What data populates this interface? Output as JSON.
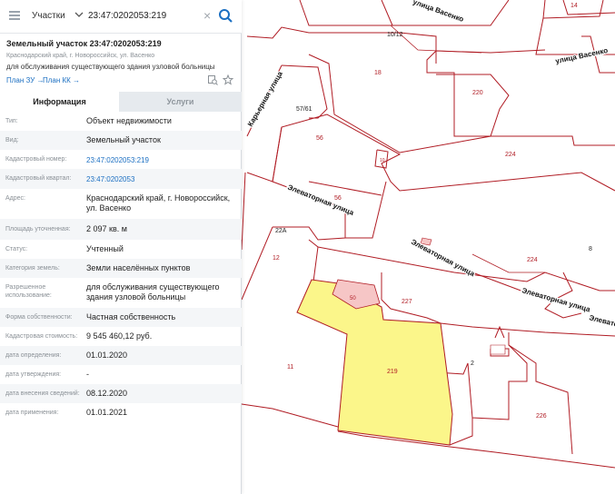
{
  "search": {
    "scope": "Участки",
    "query": "23:47:0202053:219"
  },
  "parcel": {
    "title": "Земельный участок 23:47:0202053:219",
    "address_short": "Краснодарский край, г. Новороссийск, ул. Васенко",
    "purpose": "для обслуживания существующего здания узловой больницы",
    "links": [
      "План ЗУ →",
      "План КК →"
    ]
  },
  "tabs": [
    "Информация",
    "Услуги"
  ],
  "attributes": [
    {
      "label": "Тип:",
      "value": "Объект недвижимости"
    },
    {
      "label": "Вид:",
      "value": "Земельный участок"
    },
    {
      "label": "Кадастровый номер:",
      "value": "23:47:0202053:219"
    },
    {
      "label": "Кадастровый квартал:",
      "value": "23:47:0202053"
    },
    {
      "label": "Адрес:",
      "value": "Краснодарский край, г. Новороссийск, ул. Васенко"
    },
    {
      "label": "Площадь уточненная:",
      "value": "2 097 кв. м"
    },
    {
      "label": "Статус:",
      "value": "Учтенный"
    },
    {
      "label": "Категория земель:",
      "value": "Земли населённых пунктов"
    },
    {
      "label": "Разрешенное использование:",
      "value": "для обслуживания существующего здания узловой больницы"
    },
    {
      "label": "Форма собственности:",
      "value": "Частная собственность"
    },
    {
      "label": "Кадастровая стоимость:",
      "value": "9 545 460,12 руб."
    },
    {
      "label": "дата определения:",
      "value": "01.01.2020"
    },
    {
      "label": "дата утверждения:",
      "value": "-"
    },
    {
      "label": "дата внесения сведений:",
      "value": "08.12.2020"
    },
    {
      "label": "дата применения:",
      "value": "01.01.2021"
    }
  ],
  "map": {
    "streets": [
      "улица Васенко",
      "Карьерная улица",
      "Элеваторная улица",
      "Элеваторная улица",
      "Элеваторная улица",
      "Элеваторная улица"
    ],
    "labels": [
      "14",
      "10/12",
      "18",
      "220",
      "57/61",
      "56",
      "10",
      "224",
      "56",
      "22А",
      "12",
      "8",
      "224",
      "50",
      "227",
      "2",
      "11",
      "219",
      "226"
    ],
    "colors": {
      "boundary": "#b01c24",
      "selected_fill": "#fbf68a",
      "building_fill": "#f6c6c6"
    }
  }
}
